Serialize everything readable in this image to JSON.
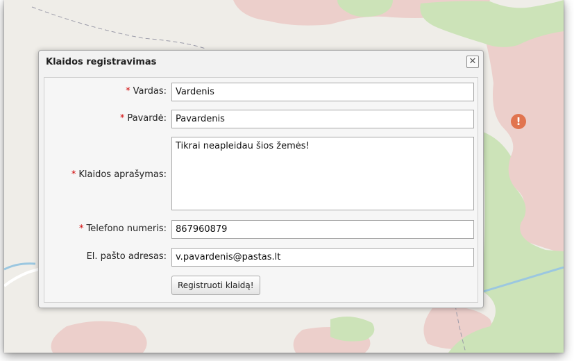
{
  "dialog": {
    "title": "Klaidos registravimas",
    "close_symbol": "✕",
    "required_mark": "*",
    "fields": {
      "vardas": {
        "label": "Vardas:",
        "value": "Vardenis",
        "required": true
      },
      "pavarde": {
        "label": "Pavardė:",
        "value": "Pavardenis",
        "required": true
      },
      "aprasymas": {
        "label": "Klaidos aprašymas:",
        "value": "Tikrai neapleidau šios žemės!",
        "required": true
      },
      "telefonas": {
        "label": "Telefono numeris:",
        "value": "867960879",
        "required": true
      },
      "pastas": {
        "label": "El. pašto adresas:",
        "value": "v.pavardenis@pastas.lt",
        "required": false
      }
    },
    "submit_label": "Registruoti klaidą!"
  },
  "map": {
    "marker_icon": "exclamation-icon",
    "marker_glyph": "!",
    "colors": {
      "background": "#efede8",
      "residential": "#eccfcb",
      "forest": "#cce3b8",
      "water": "#9bc7e0",
      "marker": "#e1744f"
    }
  },
  "colors": {
    "required": "#d00000",
    "dialog_bg": "#f2f2f2",
    "field_border": "#a6a6a6"
  }
}
